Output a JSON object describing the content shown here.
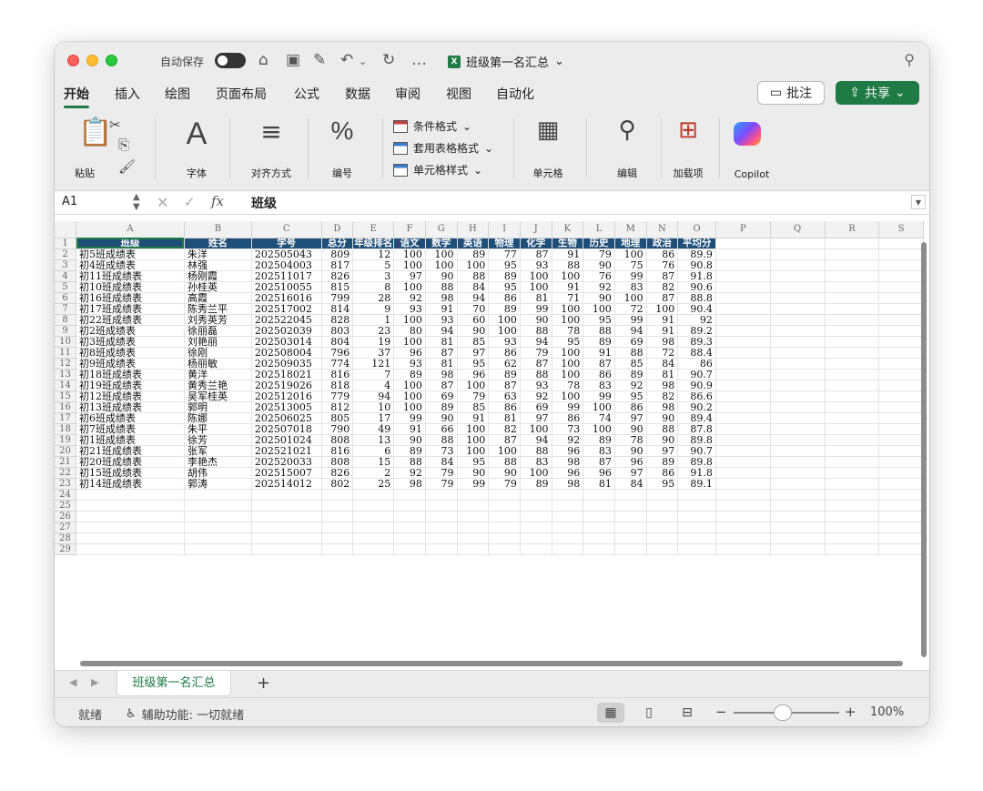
{
  "titlebar": {
    "autosave_label": "自动保存",
    "doc_title": "班级第一名汇总",
    "doc_title_chevron": "⌄"
  },
  "ribbon_tabs": [
    "开始",
    "插入",
    "绘图",
    "页面布局",
    "公式",
    "数据",
    "审阅",
    "视图",
    "自动化"
  ],
  "actions": {
    "comment_label": "批注",
    "share_label": "共享"
  },
  "ribbon": {
    "paste": "粘贴",
    "font": "字体",
    "align": "对齐方式",
    "number": "编号",
    "cond_format": "条件格式",
    "table_format": "套用表格格式",
    "cell_style": "单元格样式",
    "cells": "单元格",
    "edit": "编辑",
    "addins": "加载项",
    "copilot": "Copilot"
  },
  "formula_bar": {
    "cell_ref": "A1",
    "fx": "fx",
    "value": "班级"
  },
  "columns": [
    "A",
    "B",
    "C",
    "D",
    "E",
    "F",
    "G",
    "H",
    "I",
    "J",
    "K",
    "L",
    "M",
    "N",
    "O",
    "P",
    "Q",
    "R",
    "S"
  ],
  "table": {
    "headers": [
      "班级",
      "姓名",
      "学号",
      "总分",
      "年级排名",
      "语文",
      "数学",
      "英语",
      "物理",
      "化学",
      "生物",
      "历史",
      "地理",
      "政治",
      "平均分"
    ],
    "rows": [
      [
        "初5班成绩表",
        "朱洋",
        "202505043",
        "809",
        "12",
        "100",
        "100",
        "89",
        "77",
        "87",
        "91",
        "79",
        "100",
        "86",
        "89.9"
      ],
      [
        "初4班成绩表",
        "林强",
        "202504003",
        "817",
        "5",
        "100",
        "100",
        "100",
        "95",
        "93",
        "88",
        "90",
        "75",
        "76",
        "90.8"
      ],
      [
        "初11班成绩表",
        "杨刚霞",
        "202511017",
        "826",
        "3",
        "97",
        "90",
        "88",
        "89",
        "100",
        "100",
        "76",
        "99",
        "87",
        "91.8"
      ],
      [
        "初10班成绩表",
        "孙桂英",
        "202510055",
        "815",
        "8",
        "100",
        "88",
        "84",
        "95",
        "100",
        "91",
        "92",
        "83",
        "82",
        "90.6"
      ],
      [
        "初16班成绩表",
        "高霞",
        "202516016",
        "799",
        "28",
        "92",
        "98",
        "94",
        "86",
        "81",
        "71",
        "90",
        "100",
        "87",
        "88.8"
      ],
      [
        "初17班成绩表",
        "陈秀兰平",
        "202517002",
        "814",
        "9",
        "93",
        "91",
        "70",
        "89",
        "99",
        "100",
        "100",
        "72",
        "100",
        "90.4"
      ],
      [
        "初22班成绩表",
        "刘秀英芳",
        "202522045",
        "828",
        "1",
        "100",
        "93",
        "60",
        "100",
        "90",
        "100",
        "95",
        "99",
        "91",
        "92"
      ],
      [
        "初2班成绩表",
        "徐丽磊",
        "202502039",
        "803",
        "23",
        "80",
        "94",
        "90",
        "100",
        "88",
        "78",
        "88",
        "94",
        "91",
        "89.2"
      ],
      [
        "初3班成绩表",
        "刘艳丽",
        "202503014",
        "804",
        "19",
        "100",
        "81",
        "85",
        "93",
        "94",
        "95",
        "89",
        "69",
        "98",
        "89.3"
      ],
      [
        "初8班成绩表",
        "徐刚",
        "202508004",
        "796",
        "37",
        "96",
        "87",
        "97",
        "86",
        "79",
        "100",
        "91",
        "88",
        "72",
        "88.4"
      ],
      [
        "初9班成绩表",
        "杨丽敏",
        "202509035",
        "774",
        "121",
        "93",
        "81",
        "95",
        "62",
        "87",
        "100",
        "87",
        "85",
        "84",
        "86"
      ],
      [
        "初18班成绩表",
        "黄洋",
        "202518021",
        "816",
        "7",
        "89",
        "98",
        "96",
        "89",
        "88",
        "100",
        "86",
        "89",
        "81",
        "90.7"
      ],
      [
        "初19班成绩表",
        "黄秀兰艳",
        "202519026",
        "818",
        "4",
        "100",
        "87",
        "100",
        "87",
        "93",
        "78",
        "83",
        "92",
        "98",
        "90.9"
      ],
      [
        "初12班成绩表",
        "吴军桂英",
        "202512016",
        "779",
        "94",
        "100",
        "69",
        "79",
        "63",
        "92",
        "100",
        "99",
        "95",
        "82",
        "86.6"
      ],
      [
        "初13班成绩表",
        "郭明",
        "202513005",
        "812",
        "10",
        "100",
        "89",
        "85",
        "86",
        "69",
        "99",
        "100",
        "86",
        "98",
        "90.2"
      ],
      [
        "初6班成绩表",
        "陈娜",
        "202506025",
        "805",
        "17",
        "99",
        "90",
        "91",
        "81",
        "97",
        "86",
        "74",
        "97",
        "90",
        "89.4"
      ],
      [
        "初7班成绩表",
        "朱平",
        "202507018",
        "790",
        "49",
        "91",
        "66",
        "100",
        "82",
        "100",
        "73",
        "100",
        "90",
        "88",
        "87.8"
      ],
      [
        "初1班成绩表",
        "徐芳",
        "202501024",
        "808",
        "13",
        "90",
        "88",
        "100",
        "87",
        "94",
        "92",
        "89",
        "78",
        "90",
        "89.8"
      ],
      [
        "初21班成绩表",
        "张军",
        "202521021",
        "816",
        "6",
        "89",
        "73",
        "100",
        "100",
        "88",
        "96",
        "83",
        "90",
        "97",
        "90.7"
      ],
      [
        "初20班成绩表",
        "李艳杰",
        "202520033",
        "808",
        "15",
        "88",
        "84",
        "95",
        "88",
        "83",
        "98",
        "87",
        "96",
        "89",
        "89.8"
      ],
      [
        "初15班成绩表",
        "胡伟",
        "202515007",
        "826",
        "2",
        "92",
        "79",
        "90",
        "90",
        "100",
        "96",
        "96",
        "97",
        "86",
        "91.8"
      ],
      [
        "初14班成绩表",
        "郭涛",
        "202514012",
        "802",
        "25",
        "98",
        "79",
        "99",
        "79",
        "89",
        "98",
        "81",
        "84",
        "95",
        "89.1"
      ]
    ],
    "total_rows_shown": 29
  },
  "sheet_tabs": {
    "active": "班级第一名汇总",
    "add": "+"
  },
  "statusbar": {
    "ready": "就绪",
    "accessibility": "辅助功能: 一切就绪",
    "zoom": "100%",
    "zoom_minus": "−",
    "zoom_plus": "+"
  }
}
